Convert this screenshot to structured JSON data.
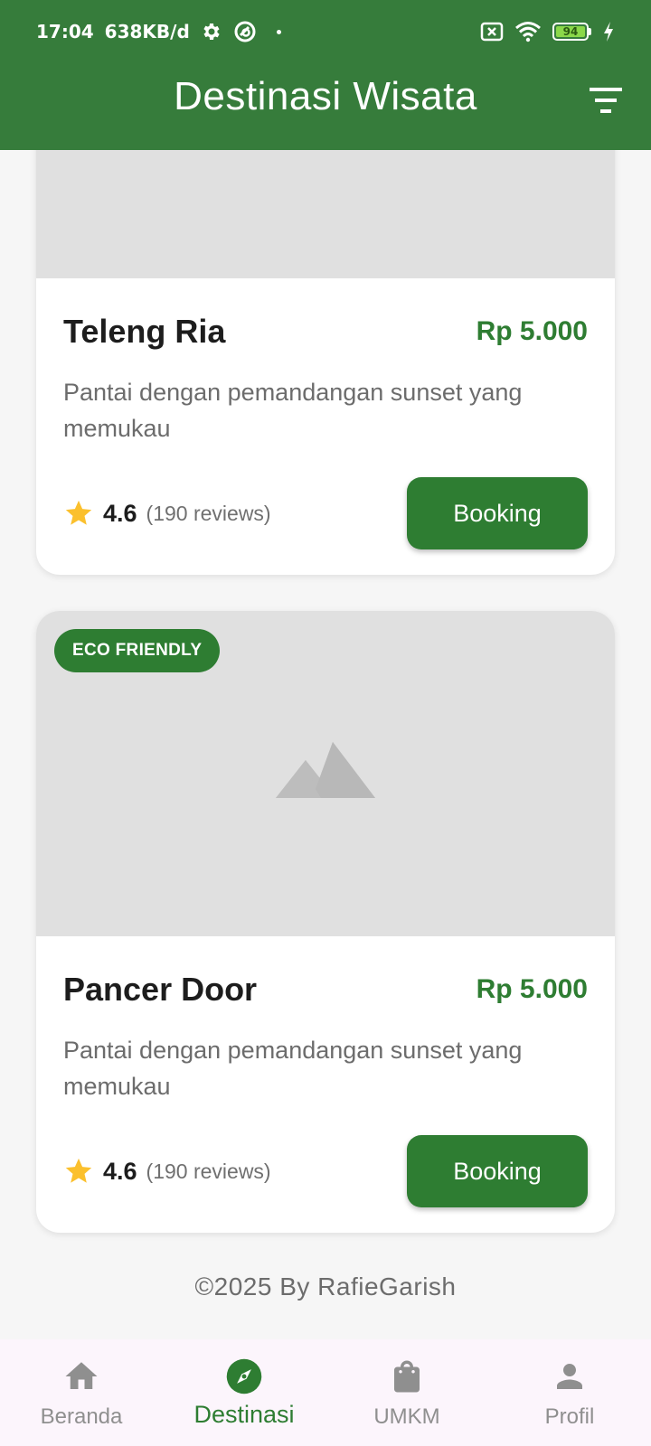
{
  "status_bar": {
    "time": "17:04",
    "net_speed": "638KB/d",
    "battery": "94"
  },
  "app_bar": {
    "title": "Destinasi Wisata"
  },
  "cards": [
    {
      "title": "Teleng Ria",
      "price": "Rp 5.000",
      "description": "Pantai dengan pemandangan sunset yang memukau",
      "rating": "4.6",
      "reviews": "(190 reviews)",
      "button": "Booking"
    },
    {
      "badge": "ECO FRIENDLY",
      "title": "Pancer Door",
      "price": "Rp 5.000",
      "description": "Pantai dengan pemandangan sunset yang memukau",
      "rating": "4.6",
      "reviews": "(190 reviews)",
      "button": "Booking"
    }
  ],
  "footer": {
    "copyright": "©2025 By RafieGarish"
  },
  "bottom_nav": {
    "items": [
      {
        "label": "Beranda",
        "icon": "home-icon"
      },
      {
        "label": "Destinasi",
        "icon": "compass-icon"
      },
      {
        "label": "UMKM",
        "icon": "shopping-bag-icon"
      },
      {
        "label": "Profil",
        "icon": "person-icon"
      }
    ],
    "active_index": 1
  },
  "colors": {
    "primary": "#2e7d32",
    "appbar": "#367c3b",
    "star": "#fbc02d",
    "image_placeholder": "#e0e0e0"
  }
}
